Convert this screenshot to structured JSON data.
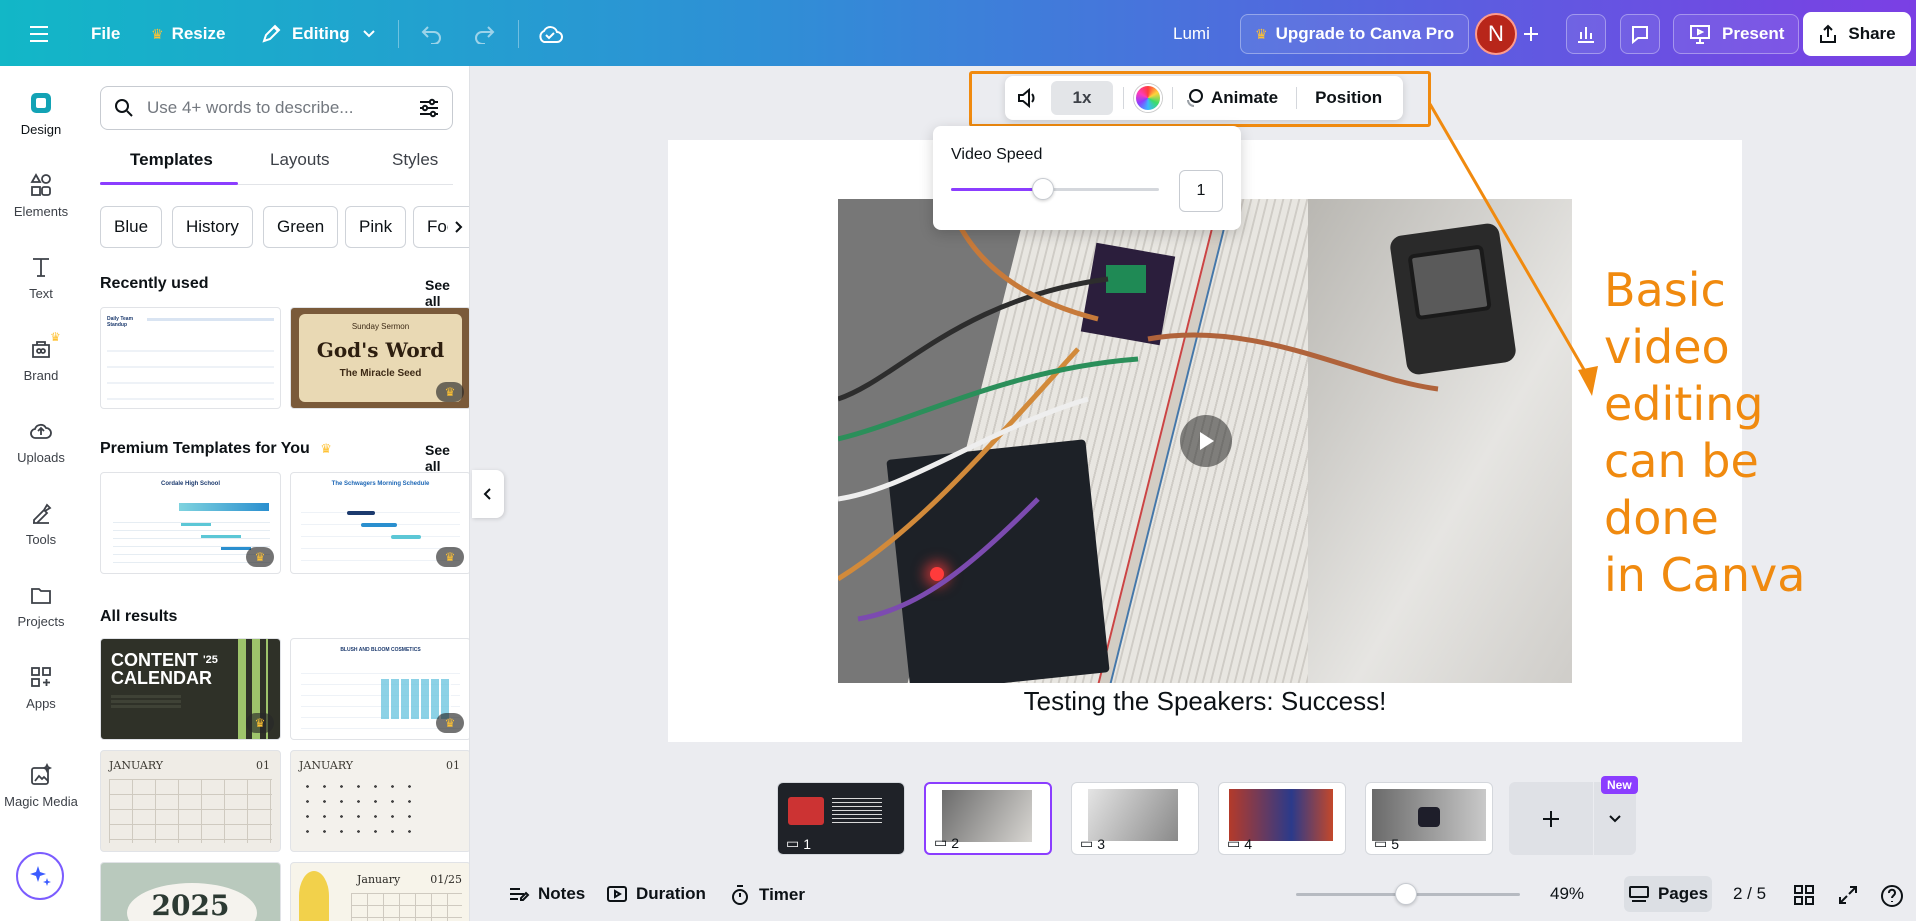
{
  "topbar": {
    "file_label": "File",
    "resize_label": "Resize",
    "editing_label": "Editing",
    "design_name": "Lumi",
    "upgrade_label": "Upgrade to Canva Pro",
    "avatar_initial": "N",
    "present_label": "Present",
    "share_label": "Share"
  },
  "rail": {
    "items": [
      {
        "label": "Design",
        "icon": "design-icon"
      },
      {
        "label": "Elements",
        "icon": "elements-icon"
      },
      {
        "label": "Text",
        "icon": "text-icon"
      },
      {
        "label": "Brand",
        "icon": "brand-icon"
      },
      {
        "label": "Uploads",
        "icon": "uploads-icon"
      },
      {
        "label": "Tools",
        "icon": "tools-icon"
      },
      {
        "label": "Projects",
        "icon": "projects-icon"
      },
      {
        "label": "Apps",
        "icon": "apps-icon"
      },
      {
        "label": "Magic Media",
        "icon": "magic-media-icon"
      }
    ]
  },
  "panel": {
    "search_placeholder": "Use 4+ words to describe...",
    "tabs": [
      "Templates",
      "Layouts",
      "Styles"
    ],
    "chips": [
      "Blue",
      "History",
      "Green",
      "Pink",
      "Food"
    ],
    "recently_used": "Recently used",
    "premium_title": "Premium Templates for You",
    "see_all": "See all",
    "all_results": "All results",
    "thumbs": {
      "standup_title": "Daily Team Standup",
      "sermon_top": "Sunday Sermon",
      "sermon_title": "God's Word",
      "sermon_sub": "The Miracle Seed",
      "cordale_title": "Cordale High School",
      "schwagers_title": "The Schwagers Morning Schedule",
      "content_title": "CONTENT",
      "content_title2": "CALENDAR",
      "content_year": "'25",
      "blush_title": "BLUSH AND BLOOM COSMETICS",
      "january": "JANUARY",
      "jan_num": "01",
      "year_2025": "2025",
      "january2": "January",
      "jan_num2": "01/25"
    }
  },
  "context_toolbar": {
    "speed_label": "1x",
    "animate_label": "Animate",
    "position_label": "Position"
  },
  "speed_popup": {
    "title": "Video Speed",
    "value": "1",
    "slider_level": 0.44
  },
  "canvas": {
    "caption": "Testing the Speakers: Success!",
    "annotation_lines": [
      "Basic",
      "video",
      "editing",
      "can be",
      "done",
      "in Canva"
    ]
  },
  "pages": {
    "thumbs": [
      "1",
      "2",
      "3",
      "4",
      "5"
    ],
    "new_badge": "New",
    "current": 2
  },
  "bottombar": {
    "notes_label": "Notes",
    "duration_label": "Duration",
    "timer_label": "Timer",
    "zoom_label": "49%",
    "zoom_level": 0.49,
    "pages_label": "Pages",
    "page_count": "2 / 5"
  },
  "colors": {
    "accent": "#8b3dff",
    "annotation": "#f08a0f"
  }
}
